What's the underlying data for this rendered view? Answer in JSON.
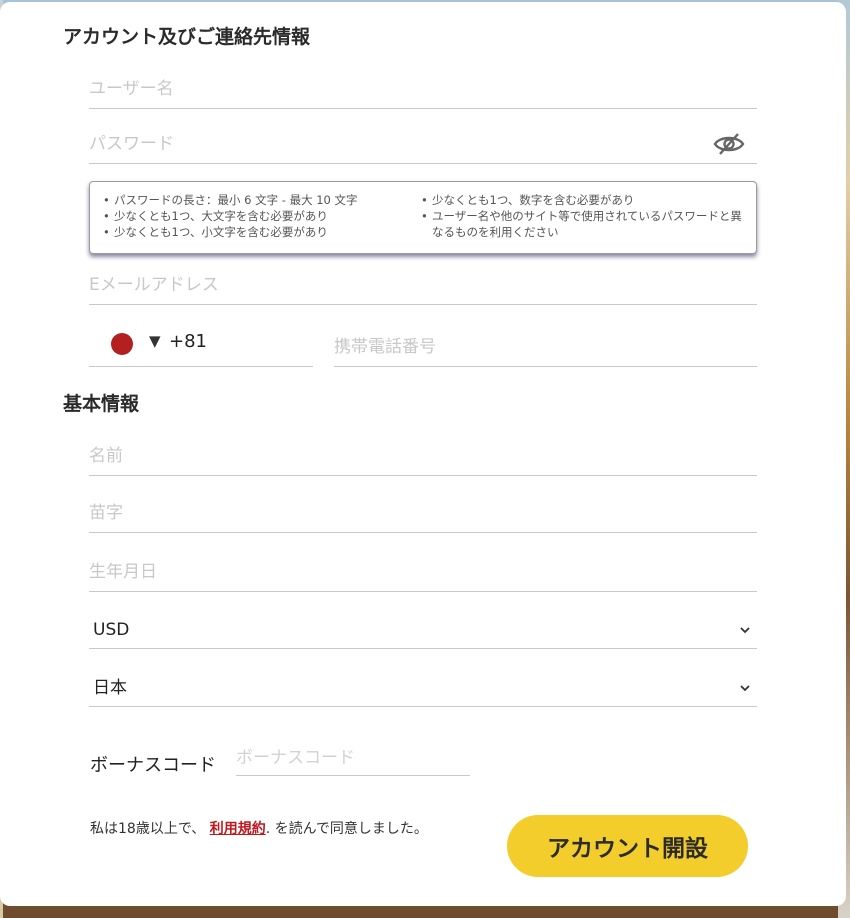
{
  "sections": {
    "account_title": "アカウント及びご連絡先情報",
    "basic_title": "基本情報"
  },
  "fields": {
    "username_placeholder": "ユーザー名",
    "password_placeholder": "パスワード",
    "email_placeholder": "Eメールアドレス",
    "phone_placeholder": "携帯電話番号",
    "first_name_placeholder": "名前",
    "last_name_placeholder": "苗字",
    "birthdate_placeholder": "生年月日"
  },
  "password_hints": {
    "col1": [
      "パスワードの長さ：最小 6 文字 - 最大 10 文字",
      "少なくとも1つ、大文字を含む必要があり",
      "少なくとも1つ、小文字を含む必要があり"
    ],
    "col2": [
      "少なくとも1つ、数字を含む必要があり",
      "ユーザー名や他のサイト等で使用されているパスワードと異なるものを利用ください"
    ]
  },
  "phone": {
    "country_code": "+81",
    "caret": "▼",
    "flag_icon": "japan-flag-icon",
    "flag_color": "#b41f1f"
  },
  "selects": {
    "currency": "USD",
    "country": "日本"
  },
  "bonus": {
    "label": "ボーナスコード",
    "placeholder": "ボーナスコード"
  },
  "terms": {
    "prefix": "私は18歳以上で、",
    "link": "利用規約",
    "suffix": ". を読んで同意しました。"
  },
  "submit_label": "アカウント開設",
  "colors": {
    "accent": "#f2cd2b",
    "link": "#c0181f"
  }
}
